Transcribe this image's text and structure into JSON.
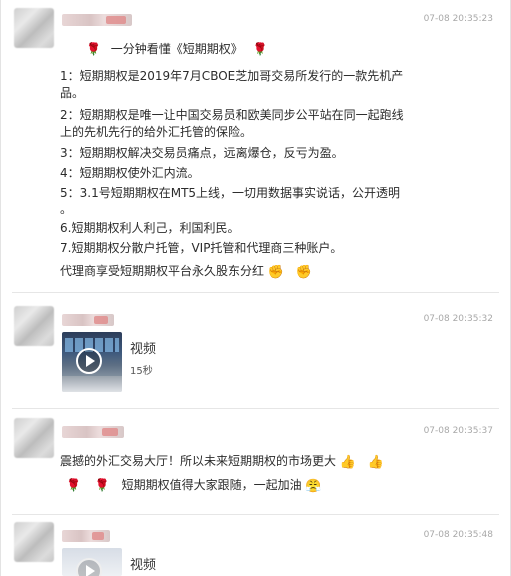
{
  "comments": [
    {
      "time": "07-08 20:35:23",
      "title": "一分钟看懂《短期期权》",
      "lines": [
        "1：短期期权是2019年7月CBOE芝加哥交易所发行的一款先机产",
        "品。",
        "2：短期期权是唯一让中国交易员和欧美同步公平站在同一起跑线",
        "上的先机先行的给外汇托管的保险。",
        "3：短期期权解决交易员痛点，远离爆仓，反亏为盈。",
        "4：短期期权使外汇内流。",
        "5：3.1号短期期权在MT5上线，一切用数据事实说话，公开透明",
        "。",
        "6.短期期权利人利己，利国利民。",
        "7.短期期权分散户托管，VIP托管和代理商三种账户。",
        "代理商享受短期期权平台永久股东分红"
      ]
    },
    {
      "time": "07-08 20:35:32",
      "video_label": "视频",
      "duration": "15秒"
    },
    {
      "time": "07-08 20:35:37",
      "lines": [
        "震撼的外汇交易大厅！所以未来短期期权的市场更大",
        "短期期权值得大家跟随，一起加油"
      ]
    },
    {
      "time": "07-08 20:35:48",
      "video_label": "视频"
    }
  ],
  "icons": {
    "rose": "rose-emoji",
    "fist": "fist-emoji",
    "thumbs_up": "thumbs-up-emoji",
    "determined_face": "determined-face-emoji"
  }
}
